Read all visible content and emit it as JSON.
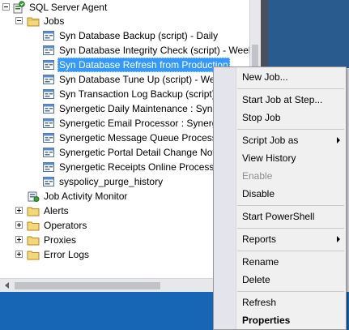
{
  "tree": {
    "root": "SQL Server Agent",
    "jobs_folder": "Jobs",
    "jobs": [
      "Syn Database Backup (script) - Daily",
      "Syn Database Integrity Check (script) - Week",
      "Syn Database Refresh from Production",
      "Syn Database Tune Up (script) - Wee",
      "Syn Transaction Log Backup (script)",
      "Synergetic Daily Maintenance : Syne",
      "Synergetic Email Processor : Synerge",
      "Synergetic Message Queue Processo",
      "Synergetic Portal Detail Change Not",
      "Synergetic Receipts Online Processo",
      "syspolicy_purge_history"
    ],
    "job_activity_monitor": "Job Activity Monitor",
    "folders": [
      "Alerts",
      "Operators",
      "Proxies",
      "Error Logs"
    ]
  },
  "menu": {
    "new_job": "New Job...",
    "start_job_at_step": "Start Job at Step...",
    "stop_job": "Stop Job",
    "script_job_as": "Script Job as",
    "view_history": "View History",
    "enable": "Enable",
    "disable": "Disable",
    "start_powershell": "Start PowerShell",
    "reports": "Reports",
    "rename": "Rename",
    "delete": "Delete",
    "refresh": "Refresh",
    "properties": "Properties"
  },
  "colors": {
    "selection": "#3399ff",
    "menu_background": "#f0f0f0",
    "bottom_bar": "#1766b5",
    "folder": "#e8c25a"
  }
}
